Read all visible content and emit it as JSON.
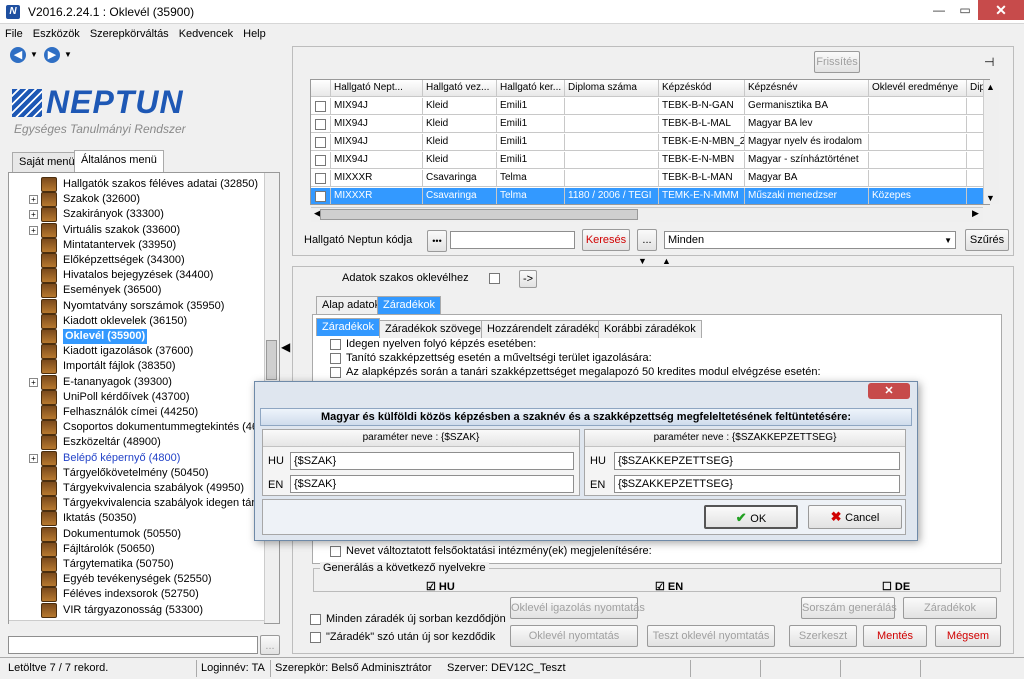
{
  "window": {
    "title": "V2016.2.24.1 : Oklevél (35900)",
    "app_icon": "N",
    "min": "—",
    "restore": "▭",
    "close": "✕"
  },
  "menu": [
    "File",
    "Eszközök",
    "Szerepkörváltás",
    "Kedvencek",
    "Help"
  ],
  "logo": {
    "name": "NEPTUN",
    "subtitle": "Egységes Tanulmányi Rendszer"
  },
  "left_tabs": [
    "Saját menü",
    "Általános menü"
  ],
  "tree": [
    {
      "label": "Hallgatók szakos féléves adatai (32850)",
      "plus": false
    },
    {
      "label": "Szakok (32600)",
      "plus": true
    },
    {
      "label": "Szakirányok (33300)",
      "plus": true
    },
    {
      "label": "Virtuális szakok (33600)",
      "plus": true
    },
    {
      "label": "Mintatantervek (33950)",
      "plus": false
    },
    {
      "label": "Előképzettségek (34300)",
      "plus": false
    },
    {
      "label": "Hivatalos bejegyzések (34400)",
      "plus": false
    },
    {
      "label": "Események (36500)",
      "plus": false
    },
    {
      "label": "Nyomtatvány sorszámok (35950)",
      "plus": false
    },
    {
      "label": "Kiadott oklevelek (36150)",
      "plus": false
    },
    {
      "label": "Oklevél (35900)",
      "plus": false,
      "selected": true
    },
    {
      "label": "Kiadott igazolások (37600)",
      "plus": false
    },
    {
      "label": "Importált fájlok (38350)",
      "plus": false
    },
    {
      "label": "E-tananyagok (39300)",
      "plus": true
    },
    {
      "label": "UniPoll kérdőívek (43700)",
      "plus": false
    },
    {
      "label": "Felhasználók címei (44250)",
      "plus": false
    },
    {
      "label": "Csoportos dokumentummegtekintés (46150)",
      "plus": false
    },
    {
      "label": "Eszközeltár (48900)",
      "plus": false
    },
    {
      "label": "Belépő képernyő (4800)",
      "plus": true,
      "link": true
    },
    {
      "label": "Tárgyelőkövetelmény (50450)",
      "plus": false
    },
    {
      "label": "Tárgyekvivalencia szabályok (49950)",
      "plus": false
    },
    {
      "label": "Tárgyekvivalencia szabályok idegen tárgyak",
      "plus": false
    },
    {
      "label": "Iktatás (50350)",
      "plus": false
    },
    {
      "label": "Dokumentumok (50550)",
      "plus": false
    },
    {
      "label": "Fájltárolók (50650)",
      "plus": false
    },
    {
      "label": "Tárgytematika (50750)",
      "plus": false
    },
    {
      "label": "Egyéb tevékenységek (52550)",
      "plus": false
    },
    {
      "label": "Féléves indexsorok (52750)",
      "plus": false
    },
    {
      "label": "VIR tárgyazonosság (53300)",
      "plus": false
    }
  ],
  "left_search": {
    "button": "..."
  },
  "top": {
    "refresh": "Frissítés"
  },
  "grid": {
    "headers": [
      "Hallgató Nept...",
      "Hallgató vez...",
      "Hallgató ker...",
      "Diploma száma",
      "Képzéskód",
      "Képzésnév",
      "Oklevél eredménye",
      "Dipl"
    ],
    "rows": [
      [
        "MIX94J",
        "Kleid",
        "Emili1",
        "",
        "TEBK-B-N-GAN",
        "Germanisztika BA",
        ""
      ],
      [
        "MIX94J",
        "Kleid",
        "Emili1",
        "",
        "TEBK-B-L-MAL",
        "Magyar BA lev",
        ""
      ],
      [
        "MIX94J",
        "Kleid",
        "Emili1",
        "",
        "TEBK-E-N-MBN_2",
        "Magyar nyelv és irodalom",
        ""
      ],
      [
        "MIX94J",
        "Kleid",
        "Emili1",
        "",
        "TEBK-E-N-MBN",
        "Magyar - színháztörténet",
        ""
      ],
      [
        "MIXXXR",
        "Csavaringa",
        "Telma",
        "",
        "TEBK-B-L-MAN",
        "Magyar BA",
        ""
      ],
      [
        "MIXXXR",
        "Csavaringa",
        "Telma",
        "1180 / 2006 / TEGI",
        "TEMK-E-N-MMM",
        "Műszaki menedzser",
        "Közepes"
      ]
    ]
  },
  "search": {
    "label": "Hallgató Neptun kódja",
    "dots": "•••",
    "button": "Keresés",
    "ellipsis": "...",
    "filter": "Minden",
    "filter_button": "Szűrés"
  },
  "detail": {
    "adatok_label": "Adatok szakos oklevélhez",
    "arrow_button": "->",
    "tabs": [
      "Alap adatok",
      "Záradékok"
    ],
    "subtabs": [
      "Záradékok",
      "Záradékok szövege",
      "Hozzárendelt záradékok",
      "Korábbi záradékok"
    ],
    "checks": [
      "Idegen nyelven folyó képzés esetében:",
      "Tanító szakképzettség esetén a műveltségi terület igazolására:",
      "Az alapképzés során a tanári szakképzettséget megalapozó 50 kredites modul elvégzése esetén:"
    ],
    "last_check": "Nevet változtatott felsőoktatási intézmény(ek) megjelenítésére:",
    "gen_label": "Generálás a következő nyelvekre",
    "langs": [
      "HU",
      "EN",
      "DE"
    ],
    "opt1": "Minden záradék új sorban kezdődjön",
    "opt2": "\"Záradék\" szó után új sor kezdődik",
    "buttons": [
      "Oklevél igazolás nyomtatás",
      "Sorszám generálás",
      "Záradékok",
      "Oklevél nyomtatás",
      "Teszt oklevél nyomtatás",
      "Szerkeszt",
      "Mentés",
      "Mégsem"
    ]
  },
  "dialog": {
    "header": "Magyar és külföldi közös képzésben a szaknév és a szakképzettség megfeleltetésének feltüntetésére:",
    "left": {
      "caption": "paraméter neve : {$SZAK}",
      "hu": "{$SZAK}",
      "en": "{$SZAK}"
    },
    "right": {
      "caption": "paraméter neve : {$SZAKKEPZETTSEG}",
      "hu": "{$SZAKKEPZETTSEG}",
      "en": "{$SZAKKEPZETTSEG}"
    },
    "hu_label": "HU",
    "en_label": "EN",
    "ok": "OK",
    "cancel": "Cancel",
    "close": "✕"
  },
  "status": {
    "records": "Letöltve 7 / 7 rekord.",
    "login": "Loginnév: TA",
    "role": "Szerepkör: Belső Adminisztrátor",
    "server": "Szerver: DEV12C_Teszt"
  }
}
